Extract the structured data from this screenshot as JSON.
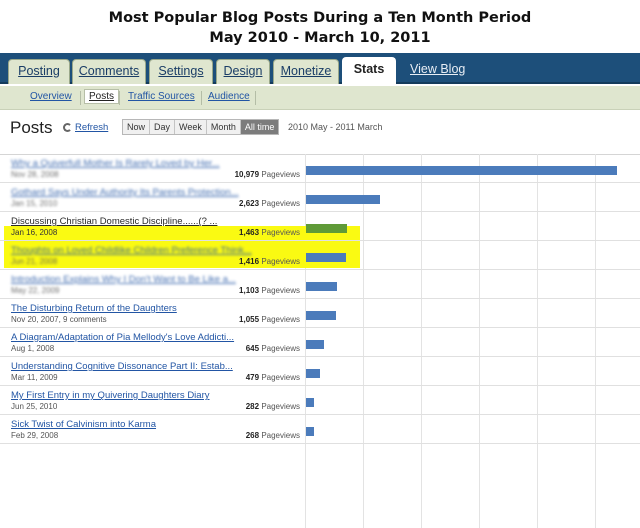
{
  "heading": {
    "line1": "Most Popular Blog Posts During a Ten Month Period",
    "line2": "May 2010 - March 10, 2011"
  },
  "tabs": [
    {
      "label": "Posting",
      "active": false
    },
    {
      "label": "Comments",
      "active": false
    },
    {
      "label": "Settings",
      "active": false
    },
    {
      "label": "Design",
      "active": false
    },
    {
      "label": "Monetize",
      "active": false
    },
    {
      "label": "Stats",
      "active": true
    }
  ],
  "view_blog": "View Blog",
  "subtabs": [
    {
      "label": "Overview",
      "active": false
    },
    {
      "label": "Posts",
      "active": true
    },
    {
      "label": "Traffic Sources",
      "active": false
    },
    {
      "label": "Audience",
      "active": false
    }
  ],
  "toolbar": {
    "title": "Posts",
    "refresh": "Refresh",
    "ranges": [
      "Now",
      "Day",
      "Week",
      "Month",
      "All time"
    ],
    "active_range": "All time",
    "date_range": "2010 May - 2011 March"
  },
  "pageviews_label": "Pageviews",
  "posts": [
    {
      "title": "Why a Quiverfull Mother Is Rarely Loved by Her...",
      "date": "Nov 28, 2008",
      "views": "10,979",
      "value": 10979,
      "obscured": true
    },
    {
      "title": "Gothard Says Under Authority Its Parents Protection...",
      "date": "Jan 15, 2010",
      "views": "2,623",
      "value": 2623,
      "obscured": true
    },
    {
      "title": "Discussing Christian Domestic Discipline......(? ...",
      "date": "Jan 16, 2008",
      "views": "1,463",
      "value": 1463,
      "highlighted": true
    },
    {
      "title": "Thoughts on Loved Childlike Children Preference Think...",
      "date": "Jun 21, 2008",
      "views": "1,416",
      "value": 1416,
      "obscured": true
    },
    {
      "title": "Introduction Explains Why I Don't Want to Be Like a...",
      "date": "May 22, 2009",
      "views": "1,103",
      "value": 1103,
      "obscured": true
    },
    {
      "title": "The Disturbing Return of the Daughters",
      "date": "Nov 20, 2007, 9 comments",
      "views": "1,055",
      "value": 1055
    },
    {
      "title": "A Diagram/Adaptation of Pia Mellody's Love Addicti...",
      "date": "Aug 1, 2008",
      "views": "645",
      "value": 645
    },
    {
      "title": "Understanding Cognitive Dissonance Part II: Estab...",
      "date": "Mar 11, 2009",
      "views": "479",
      "value": 479
    },
    {
      "title": "My First Entry in my Quivering Daughters Diary",
      "date": "Jun 25, 2010",
      "views": "282",
      "value": 282
    },
    {
      "title": "Sick Twist of Calvinism into Karma",
      "date": "Feb 29, 2008",
      "views": "268",
      "value": 268
    }
  ],
  "colors": {
    "tabbar": "#1d4f7a",
    "subnav": "#dfe6cf",
    "bar": "#4b7bbb",
    "bar_highlight": "#5f9a38",
    "highlight": "#fafa12"
  }
}
